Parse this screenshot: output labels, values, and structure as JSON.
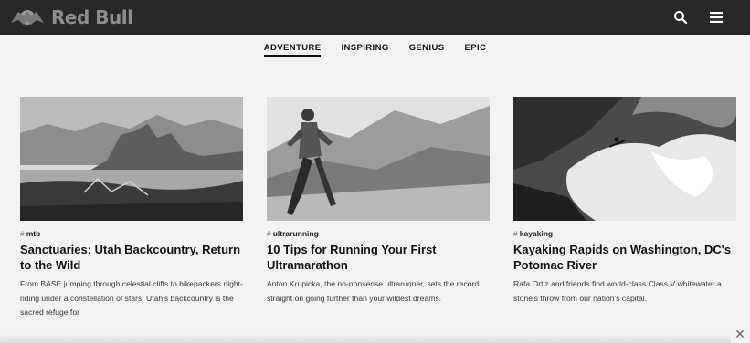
{
  "header": {
    "brand": "Red Bull",
    "logo_icon": "red-bull-logo-icon",
    "search_icon": "search-icon",
    "menu_icon": "menu-icon"
  },
  "tabs": [
    {
      "label": "ADVENTURE",
      "active": true
    },
    {
      "label": "INSPIRING",
      "active": false
    },
    {
      "label": "GENIUS",
      "active": false
    },
    {
      "label": "EPIC",
      "active": false
    }
  ],
  "cards": [
    {
      "tag": "mtb",
      "title": "Sanctuaries: Utah Backcountry, Return to the Wild",
      "description": "From BASE jumping through celestial cliffs to bikepackers night-riding under a constellation of stars, Utah's backcountry is the sacred refuge for"
    },
    {
      "tag": "ultrarunning",
      "title": "10 Tips for Running Your First Ultramarathon",
      "description": "Anton Krupicka, the no-nonsense ultrarunner, sets the record straight on going further than your wildest dreams."
    },
    {
      "tag": "kayaking",
      "title": "Kayaking Rapids on Washington, DC's Potomac River",
      "description": "Rafa Ortiz and friends find world-class Class V whitewater a stone's throw from our nation's capital."
    }
  ],
  "footer": {
    "close_label": "✕"
  }
}
